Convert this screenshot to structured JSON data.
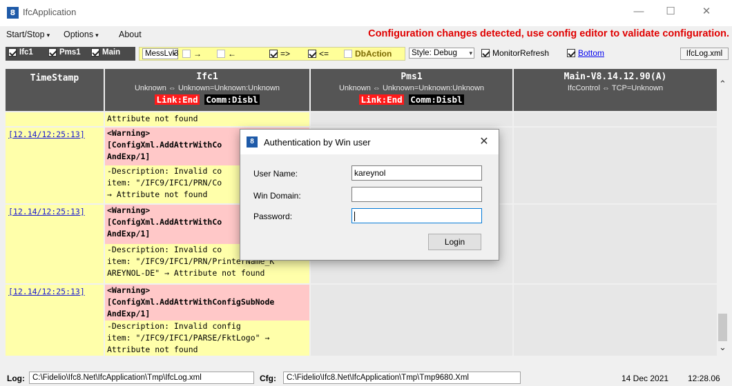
{
  "window": {
    "title": "IfcApplication",
    "icon_text": "8",
    "icon_sub": "IFC",
    "controls": {
      "minimize": "—",
      "maximize": "☐",
      "close": "✕"
    }
  },
  "menu": {
    "items": [
      {
        "label": "Start/Stop",
        "caret": "▾"
      },
      {
        "label": "Options",
        "caret": "▾"
      },
      {
        "label": "About",
        "caret": ""
      }
    ],
    "alert": "Configuration changes detected, use config editor to validate configuration."
  },
  "toolbar": {
    "dark": [
      {
        "label": "Ifc1",
        "checked": true
      },
      {
        "label": "Pms1",
        "checked": true
      },
      {
        "label": "Main",
        "checked": true
      }
    ],
    "level_select": "MessLvl3",
    "arrows": [
      {
        "label": "→",
        "checked": false
      },
      {
        "label": "←",
        "checked": false
      },
      {
        "label": "=>",
        "checked": true
      },
      {
        "label": "<=",
        "checked": true
      }
    ],
    "dbaction": "DbAction",
    "style_select": "Style: Debug",
    "monitor_refresh": "MonitorRefresh",
    "bottom_link": "Bottom",
    "log_button": "IfcLog.xml",
    "dropdown_icon": "▾"
  },
  "grid": {
    "headers": [
      {
        "title": "TimeStamp",
        "sub": "",
        "link": "",
        "comm": ""
      },
      {
        "title": "Ifc1",
        "sub": "Unknown ⇔ Unknown=Unknown:Unknown",
        "link": "Link:End",
        "comm": "Comm:Disbl"
      },
      {
        "title": "Pms1",
        "sub": "Unknown ⇔ Unknown=Unknown:Unknown",
        "link": "Link:End",
        "comm": "Comm:Disbl"
      },
      {
        "title": "Main-V8.14.12.90(A)",
        "sub": "IfcControl ⇔ TCP=Unknown",
        "link": "",
        "comm": ""
      }
    ],
    "rows": [
      {
        "ts": "",
        "lines": [
          "Attribute not found"
        ]
      },
      {
        "ts": "[12.14/12:25:13]",
        "warn": [
          "<Warning>",
          "[ConfigXml.AddAttrWithCo",
          "AndExp/1]"
        ],
        "desc": [
          "-Description: Invalid co",
          "item: \"/IFC9/IFC1/PRN/Co",
          "→ Attribute not found"
        ]
      },
      {
        "ts": "[12.14/12:25:13]",
        "warn": [
          "<Warning>",
          "[ConfigXml.AddAttrWithCo",
          "AndExp/1]"
        ],
        "desc": [
          "-Description: Invalid co",
          "item: \"/IFC9/IFC1/PRN/PrinterName_K",
          "AREYNOL-DE\" → Attribute not found"
        ]
      },
      {
        "ts": "[12.14/12:25:13]",
        "warn": [
          "<Warning>",
          "[ConfigXml.AddAttrWithConfigSubNode",
          "AndExp/1]"
        ],
        "desc": [
          "-Description: Invalid config",
          "item: \"/IFC9/IFC1/PARSE/FktLogo\" →",
          "Attribute not found"
        ]
      }
    ],
    "scroll_up": "⌃",
    "scroll_down": "⌄"
  },
  "statusbar": {
    "log_label": "Log:",
    "log_path": "C:\\Fidelio\\Ifc8.Net\\IfcApplication\\Tmp\\IfcLog.xml",
    "cfg_label": "Cfg:",
    "cfg_path": "C:\\Fidelio\\Ifc8.Net\\IfcApplication\\Tmp\\Tmp9680.Xml",
    "date": "14 Dec 2021",
    "time": "12:28.06"
  },
  "dialog": {
    "title": "Authentication by Win user",
    "close": "✕",
    "user_label": "User Name:",
    "user_value": "kareynol",
    "domain_label": "Win Domain:",
    "domain_value": "",
    "password_label": "Password:",
    "password_value": "",
    "login_button": "Login"
  }
}
